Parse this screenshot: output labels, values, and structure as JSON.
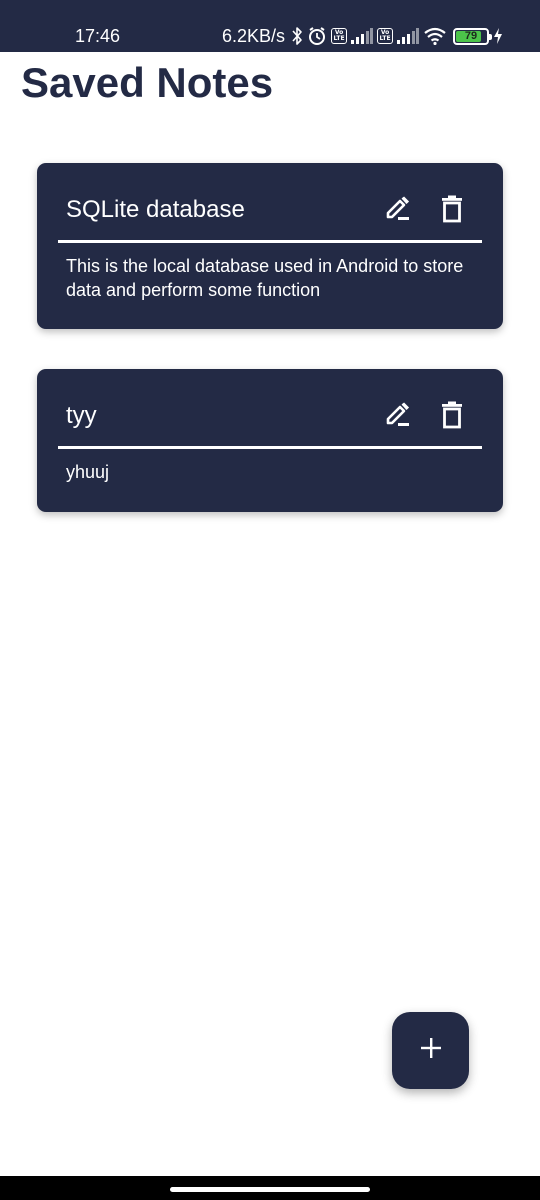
{
  "status_bar": {
    "time": "17:46",
    "net_speed": "6.2KB/s",
    "battery_level": "79",
    "icons": [
      "bluetooth-icon",
      "alarm-icon",
      "volte-icon",
      "signal-icon",
      "volte-icon",
      "signal-icon",
      "wifi-icon",
      "battery-icon",
      "charging-icon"
    ],
    "volte_label_top": "Vo",
    "volte_label_bottom": "LTE"
  },
  "page": {
    "title": "Saved Notes"
  },
  "notes": [
    {
      "title": "SQLite database",
      "body": "This is the local database used in Android to store data and perform some function",
      "edit_icon": "edit-pencil-icon",
      "delete_icon": "trash-icon"
    },
    {
      "title": "tyy",
      "body": "yhuuj",
      "edit_icon": "edit-pencil-icon",
      "delete_icon": "trash-icon"
    }
  ],
  "fab": {
    "icon": "plus-icon"
  },
  "colors": {
    "primary": "#232a45",
    "background": "#ffffff",
    "battery_fill": "#4cc44a"
  }
}
